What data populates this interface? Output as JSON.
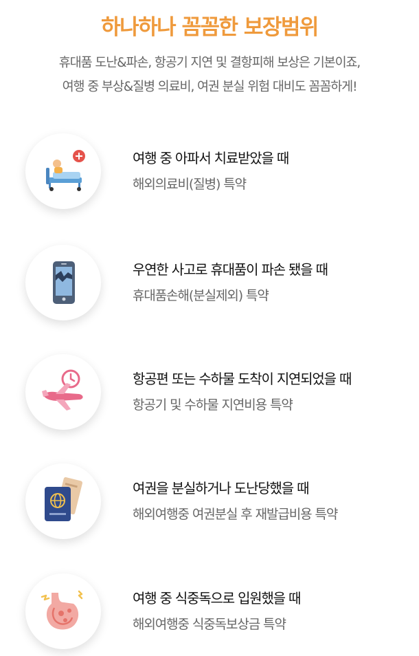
{
  "header": {
    "title": "하나하나 꼼꼼한 보장범위",
    "subtitle_line1": "휴대품 도난&파손, 항공기 지연 및 결항피해 보상은 기본이죠,",
    "subtitle_line2": "여행 중 부상&질병 의료비, 여권 분실 위험 대비도 꼼꼼하게!"
  },
  "items": [
    {
      "icon": "hospital-bed-icon",
      "heading": "여행 중 아파서 치료받았을 때",
      "sub": "해외의료비(질병) 특약"
    },
    {
      "icon": "broken-phone-icon",
      "heading": "우연한 사고로 휴대품이 파손 됐을 때",
      "sub": "휴대품손해(분실제외) 특약"
    },
    {
      "icon": "airplane-clock-icon",
      "heading": "항공편 또는 수하물 도착이 지연되었을 때",
      "sub": "항공기 및 수하물 지연비용 특약"
    },
    {
      "icon": "passport-ticket-icon",
      "heading": "여권을 분실하거나 도난당했을 때",
      "sub": "해외여행중 여권분실 후 재발급비용 특약"
    },
    {
      "icon": "stomach-icon",
      "heading": "여행 중 식중독으로 입원했을 때",
      "sub": "해외여행중 식중독보상금 특약"
    }
  ],
  "colors": {
    "title": "#ef9a3c",
    "subtitle": "#666666",
    "heading": "#111111"
  }
}
